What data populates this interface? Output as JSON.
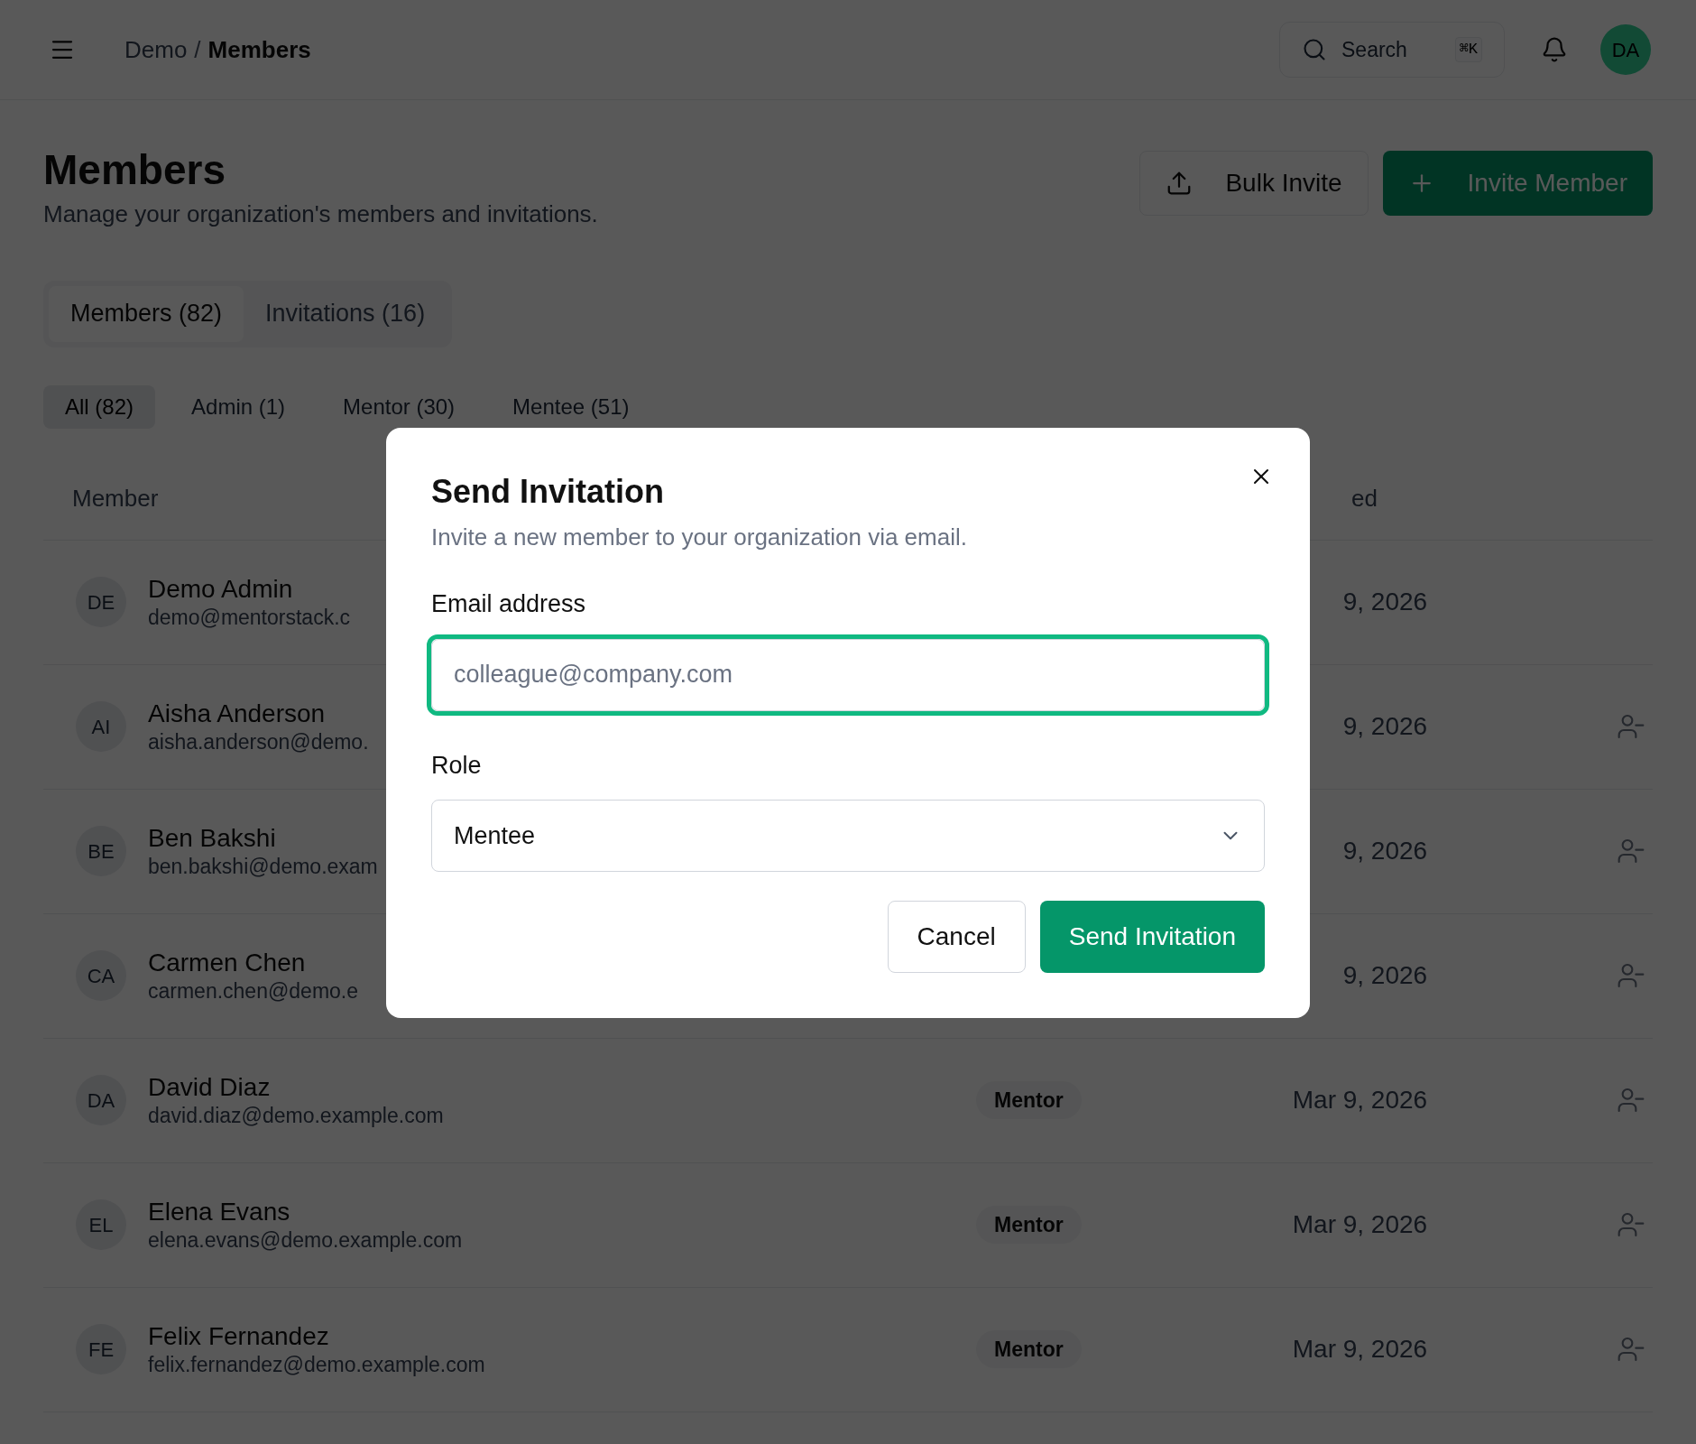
{
  "breadcrumb": [
    "Demo",
    "Members"
  ],
  "breadcrumb_separator": "/",
  "search": {
    "placeholder": "Search",
    "shortcut": "⌘K"
  },
  "user": {
    "initials": "DA"
  },
  "header": {
    "title": "Members",
    "subtitle": "Manage your organization's members and invitations.",
    "buttons": [
      {
        "label": "Bulk Invite",
        "kind": "upload"
      },
      {
        "label": "Invite Member",
        "kind": "primary"
      }
    ]
  },
  "tabs": [
    {
      "label": "Members (82)",
      "selected": true
    },
    {
      "label": "Invitations (16)",
      "selected": false
    }
  ],
  "filters": [
    {
      "label": "All (82)",
      "selected": true
    },
    {
      "label": "Admin (1)",
      "selected": false
    },
    {
      "label": "Mentor (30)",
      "selected": false
    },
    {
      "label": "Mentee (51)",
      "selected": false
    }
  ],
  "table": {
    "columns": [
      "Member",
      "ed"
    ],
    "rows": [
      {
        "initials": "DE",
        "name": "Demo Admin",
        "email": "demo@mentorstack.c",
        "date": "9, 2026",
        "removable": false
      },
      {
        "initials": "AI",
        "name": "Aisha Anderson",
        "email": "aisha.anderson@demo.",
        "date": "9, 2026",
        "removable": true
      },
      {
        "initials": "BE",
        "name": "Ben Bakshi",
        "email": "ben.bakshi@demo.exam",
        "date": "9, 2026",
        "removable": true
      },
      {
        "initials": "CA",
        "name": "Carmen Chen",
        "email": "carmen.chen@demo.e",
        "date": "9, 2026",
        "removable": true
      },
      {
        "initials": "DA",
        "name": "David Diaz",
        "email": "david.diaz@demo.example.com",
        "role": "Mentor",
        "date": "Mar 9, 2026",
        "removable": true
      },
      {
        "initials": "EL",
        "name": "Elena Evans",
        "email": "elena.evans@demo.example.com",
        "role": "Mentor",
        "date": "Mar 9, 2026",
        "removable": true
      },
      {
        "initials": "FE",
        "name": "Felix Fernandez",
        "email": "felix.fernandez@demo.example.com",
        "role": "Mentor",
        "date": "Mar 9, 2026",
        "removable": true
      }
    ]
  },
  "dialog": {
    "title": "Send Invitation",
    "description": "Invite a new member to your organization via email.",
    "email": {
      "label": "Email address",
      "placeholder": "colleague@company.com",
      "focused": true
    },
    "role": {
      "label": "Role",
      "value": "Mentee"
    },
    "buttons": [
      {
        "label": "Cancel",
        "kind": "secondary"
      },
      {
        "label": "Send Invitation",
        "kind": "primary"
      }
    ]
  }
}
